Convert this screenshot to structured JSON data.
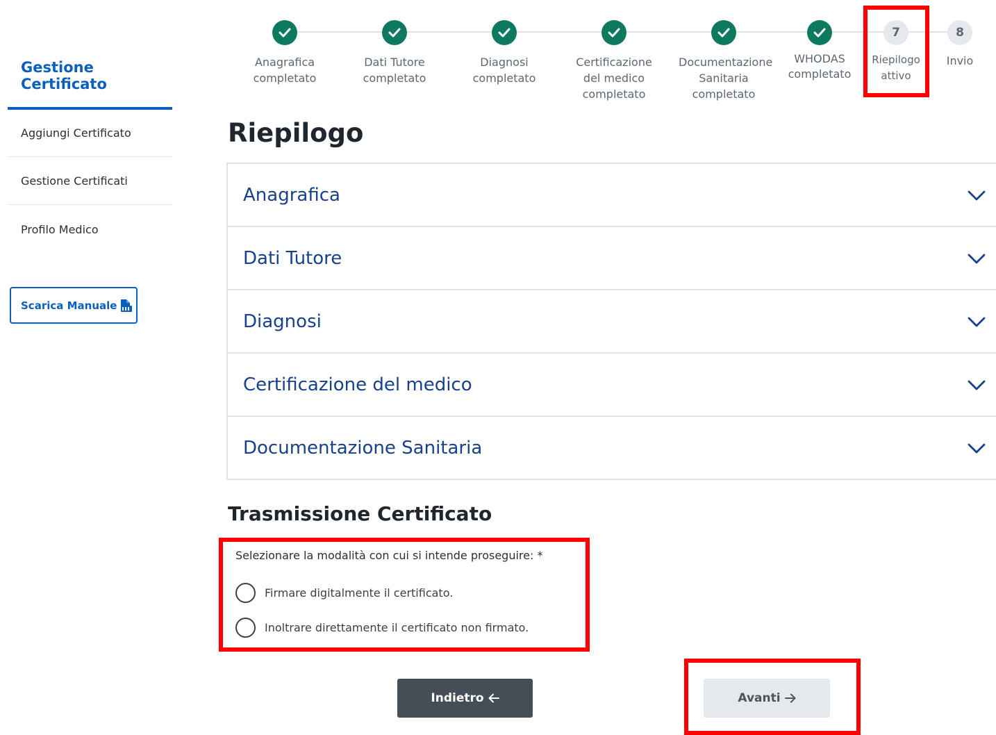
{
  "sidebar": {
    "title": "Gestione Certificato",
    "items": [
      {
        "label": "Aggiungi Certificato"
      },
      {
        "label": "Gestione Certificati"
      },
      {
        "label": "Profilo Medico"
      }
    ],
    "manual_button": "Scarica Manuale"
  },
  "stepper": {
    "steps": [
      {
        "label": "Anagrafica completato",
        "status": "done",
        "icon": "check-icon"
      },
      {
        "label": "Dati Tutore completato",
        "status": "done",
        "icon": "check-icon"
      },
      {
        "label": "Diagnosi completato",
        "status": "done",
        "icon": "check-icon"
      },
      {
        "label": "Certificazione del medico completato",
        "status": "done",
        "icon": "check-icon"
      },
      {
        "label": "Documentazione Sanitaria completato",
        "status": "done",
        "icon": "check-icon"
      },
      {
        "label": "WHODAS completato",
        "status": "done",
        "icon": "check-icon"
      },
      {
        "number": "7",
        "label": "Riepilogo attivo",
        "status": "active"
      },
      {
        "number": "8",
        "label": "Invio",
        "status": "pending"
      }
    ]
  },
  "main": {
    "title": "Riepilogo",
    "accordion": [
      {
        "label": "Anagrafica"
      },
      {
        "label": "Dati Tutore"
      },
      {
        "label": "Diagnosi"
      },
      {
        "label": "Certificazione del medico"
      },
      {
        "label": "Documentazione Sanitaria"
      }
    ],
    "transmission": {
      "title": "Trasmissione Certificato",
      "question": "Selezionare la modalità con cui si intende proseguire: *",
      "options": [
        {
          "label": "Firmare digitalmente il certificato."
        },
        {
          "label": "Inoltrare direttamente il certificato non firmato."
        }
      ]
    },
    "buttons": {
      "back": "Indietro",
      "next": "Avanti"
    }
  },
  "colors": {
    "primary": "#0b5fbd",
    "accordion_text": "#17418a",
    "step_done": "#0d7a5f",
    "highlight": "#ff0000",
    "back_button": "#454d56",
    "next_button_disabled": "#e5e8ec"
  }
}
